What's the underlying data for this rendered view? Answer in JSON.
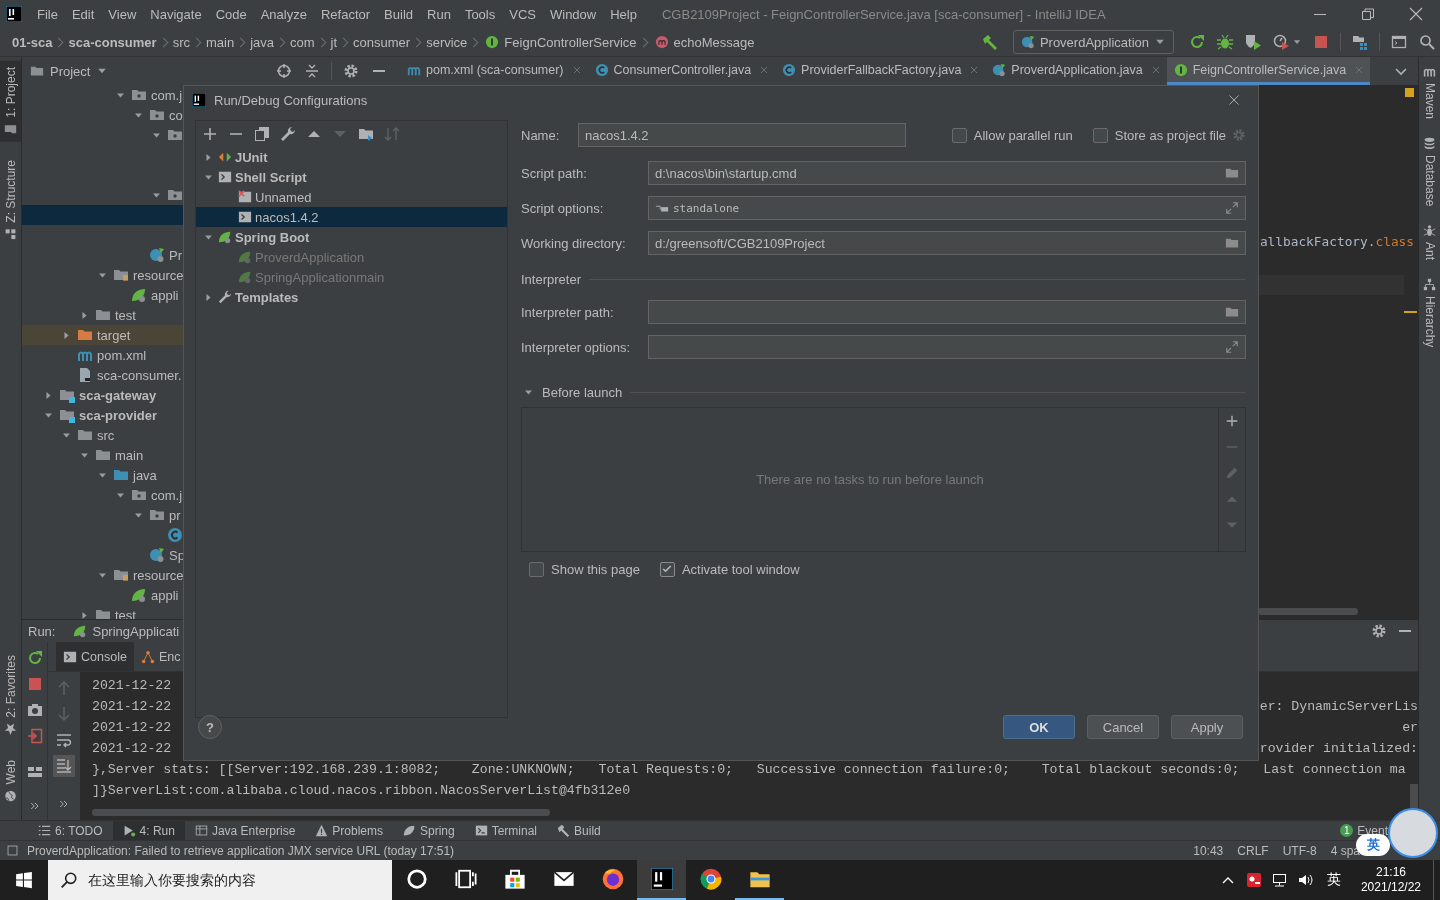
{
  "window": {
    "title": "CGB2109Project - FeignControllerService.java [sca-consumer] - IntelliJ IDEA"
  },
  "menu": [
    "File",
    "Edit",
    "View",
    "Navigate",
    "Code",
    "Analyze",
    "Refactor",
    "Build",
    "Run",
    "Tools",
    "VCS",
    "Window",
    "Help"
  ],
  "breadcrumbs": [
    {
      "label": "01-sca",
      "kind": "module"
    },
    {
      "label": "sca-consumer",
      "kind": "module"
    },
    {
      "label": "src",
      "kind": "dir"
    },
    {
      "label": "main",
      "kind": "dir"
    },
    {
      "label": "java",
      "kind": "dir"
    },
    {
      "label": "com",
      "kind": "dir"
    },
    {
      "label": "jt",
      "kind": "dir"
    },
    {
      "label": "consumer",
      "kind": "dir"
    },
    {
      "label": "service",
      "kind": "dir"
    },
    {
      "label": "FeignControllerService",
      "kind": "interface"
    },
    {
      "label": "echoMessage",
      "kind": "method"
    }
  ],
  "run_config": {
    "label": "ProverdApplication"
  },
  "left_strip": [
    {
      "label": "1: Project",
      "kind": "folder",
      "selected": true
    },
    {
      "label": "Z: Structure",
      "kind": "structure",
      "selected": false
    }
  ],
  "left_strip_bottom": [
    {
      "label": "2: Favorites",
      "kind": "star"
    },
    {
      "label": "Web",
      "kind": "globe"
    }
  ],
  "right_strip": [
    {
      "label": "Maven",
      "kind": "maven"
    },
    {
      "label": "Database",
      "kind": "database"
    },
    {
      "label": "Ant",
      "kind": "ant"
    },
    {
      "label": "Hierarchy",
      "kind": "hierarchy"
    }
  ],
  "project": {
    "title": "Project",
    "tree": [
      {
        "children": [
          {
            "children": [
              {
                "children": [
                  {
                    "children": [
                      {
                        "label": "com.j",
                        "kind": "package",
                        "expanded": true,
                        "selected": false,
                        "children": [
                          {
                            "label": "co",
                            "kind": "package",
                            "expanded": true,
                            "selected": false,
                            "children": [
                              {
                                "kind": "package",
                                "expanded": true,
                                "selected": false,
                                "children": [
                                  {
                                    "selected": false
                                  },
                                  {
                                    "selected": false
                                  }
                                ]
                              },
                              {
                                "kind": "package",
                                "expanded": true,
                                "selected": false,
                                "children": [
                                  {
                                    "selected": true
                                  },
                                  {
                                    "selected": false
                                  }
                                ]
                              }
                            ]
                          },
                          {
                            "label": "Pr",
                            "kind": "springapp",
                            "selected": false
                          }
                        ]
                      }
                    ]
                  },
                  {
                    "label": "resource",
                    "kind": "res",
                    "expanded": true,
                    "selected": false,
                    "children": [
                      {
                        "label": "appli",
                        "kind": "spring",
                        "selected": false
                      }
                    ]
                  }
                ]
              },
              {
                "label": "test",
                "kind": "folder",
                "expanded": false,
                "selected": false
              }
            ]
          },
          {
            "label": "target",
            "kind": "excluded",
            "expanded": false,
            "selected": false
          },
          {
            "label": "pom.xml",
            "kind": "maven",
            "selected": false
          },
          {
            "label": "sca-consumer.",
            "kind": "file",
            "selected": false
          }
        ]
      },
      {
        "label": "sca-gateway",
        "kind": "module",
        "expanded": false,
        "selected": false
      },
      {
        "label": "sca-provider",
        "kind": "module",
        "expanded": true,
        "selected": false,
        "children": [
          {
            "label": "src",
            "kind": "folder",
            "expanded": true,
            "selected": false,
            "children": [
              {
                "label": "main",
                "kind": "folder",
                "expanded": true,
                "selected": false,
                "children": [
                  {
                    "label": "java",
                    "kind": "src",
                    "expanded": true,
                    "selected": false,
                    "children": [
                      {
                        "label": "com.j",
                        "kind": "package",
                        "expanded": true,
                        "selected": false,
                        "children": [
                          {
                            "label": "pr",
                            "kind": "package",
                            "expanded": true,
                            "selected": false,
                            "children": [
                              {
                                "kind": "class",
                                "selected": false
                              }
                            ]
                          },
                          {
                            "label": "Sp",
                            "kind": "springapp",
                            "selected": false
                          }
                        ]
                      }
                    ]
                  },
                  {
                    "label": "resource",
                    "kind": "res",
                    "expanded": true,
                    "selected": false,
                    "children": [
                      {
                        "label": "appli",
                        "kind": "spring",
                        "selected": false
                      }
                    ]
                  }
                ]
              },
              {
                "label": "test",
                "kind": "folder",
                "expanded": false,
                "selected": false
              }
            ]
          }
        ]
      }
    ]
  },
  "editor_tabs": [
    {
      "label": "pom.xml (sca-consumer)",
      "kind": "maven",
      "selected": false
    },
    {
      "label": "ConsumerController.java",
      "kind": "class",
      "selected": false
    },
    {
      "label": "ProviderFallbackFactory.java",
      "kind": "class",
      "selected": false
    },
    {
      "label": "ProverdApplication.java",
      "kind": "springapp",
      "selected": false
    },
    {
      "label": "FeignControllerService.java",
      "kind": "interface",
      "selected": true
    }
  ],
  "editor": {
    "code": [
      {
        "text": "allbackFactory.",
        "kind": "plain"
      },
      {
        "text": "class",
        "kind": "keyword"
      }
    ]
  },
  "run_panel": {
    "label": "Run:",
    "config": "SpringApplicati",
    "tabs": [
      {
        "label": "Console",
        "kind": "console",
        "selected": true
      },
      {
        "label": "Enc",
        "kind": "nodes",
        "selected": false
      }
    ],
    "lines": [
      {
        "text": "2021-12-22"
      },
      {
        "text": "2021-12-22",
        "end": "er: DynamicServerLis"
      },
      {
        "text": "2021-12-22",
        "end": "er"
      },
      {
        "text": "2021-12-22",
        "end": "rovider initialized:"
      },
      {
        "text": "},Server stats: [[Server:192.168.239.1:8082;    Zone:UNKNOWN;   Total Requests:0;   Successive connection failure:0;    Total blackout seconds:0;   Last connection ma"
      },
      {
        "text": "]}ServerList:com.alibaba.cloud.nacos.ribbon.NacosServerList@4fb312e0"
      }
    ]
  },
  "tool_windows": [
    {
      "label": "6: TODO",
      "kind": "list",
      "selected": false
    },
    {
      "label": "4: Run",
      "kind": "run",
      "selected": true
    },
    {
      "label": "Java Enterprise",
      "kind": "table",
      "selected": false
    },
    {
      "label": "Problems",
      "kind": "warning",
      "selected": false
    },
    {
      "label": "Spring",
      "kind": "springgrey",
      "selected": false
    },
    {
      "label": "Terminal",
      "kind": "terminal",
      "selected": false
    },
    {
      "label": "Build",
      "kind": "hammergrey",
      "selected": false
    }
  ],
  "event_log": {
    "count": "1",
    "label": "Event"
  },
  "status_bar": {
    "message": "ProverdApplication: Failed to retrieve application JMX service URL (today 17:51)",
    "items": [
      "10:43",
      "CRLF",
      "UTF-8",
      "4 spa"
    ]
  },
  "ime_widget": {
    "label": "英"
  },
  "taskbar": {
    "search_placeholder": "在这里输入你要搜索的内容",
    "apps": [
      {
        "kind": "cortana",
        "selected": false,
        "running": false
      },
      {
        "kind": "taskview",
        "selected": false,
        "running": false
      },
      {
        "kind": "store",
        "selected": false,
        "running": false
      },
      {
        "kind": "mail",
        "selected": false,
        "running": false
      },
      {
        "kind": "firefox",
        "selected": false,
        "running": false
      },
      {
        "kind": "logo",
        "selected": true,
        "running": true
      },
      {
        "kind": "chrome",
        "selected": false,
        "running": false
      },
      {
        "kind": "explorer",
        "selected": false,
        "running": true
      }
    ],
    "ime": "英",
    "time": "21:16",
    "date": "2021/12/22"
  },
  "dialog": {
    "title": "Run/Debug Configurations",
    "tree": [
      {
        "label": "JUnit",
        "kind": "junit",
        "expanded": false,
        "selected": false
      },
      {
        "label": "Shell Script",
        "kind": "shell",
        "expanded": true,
        "selected": false,
        "children": [
          {
            "label": "Unnamed",
            "kind": "shellerr",
            "selected": false,
            "temporary": false
          },
          {
            "label": "nacos1.4.2",
            "kind": "shell",
            "selected": true,
            "temporary": false
          }
        ]
      },
      {
        "label": "Spring Boot",
        "kind": "spring",
        "expanded": true,
        "selected": false,
        "children": [
          {
            "label": "ProverdApplication",
            "kind": "spring",
            "selected": false,
            "temporary": true
          },
          {
            "label": "SpringApplicationmain",
            "kind": "spring",
            "selected": false,
            "temporary": true
          }
        ]
      },
      {
        "label": "Templates",
        "kind": "wrench",
        "expanded": false,
        "selected": false
      }
    ],
    "name": {
      "label": "Name:",
      "value": "nacos1.4.2"
    },
    "options": [
      {
        "label": "Allow parallel run",
        "checked": false
      },
      {
        "label": "Store as project file",
        "checked": false
      }
    ],
    "fields": [
      {
        "label": "Script path:",
        "value": "d:\\nacos\\bin\\startup.cmd",
        "kind": "browse"
      },
      {
        "label": "Script options:",
        "value": "standalone",
        "kind": "options"
      },
      {
        "label": "Working directory:",
        "value": "d:/greensoft/CGB2109Project",
        "kind": "browse"
      },
      {
        "label": "Interpreter",
        "kind": "section"
      },
      {
        "label": "Interpreter path:",
        "kind": "browse"
      },
      {
        "label": "Interpreter options:",
        "kind": "expand"
      }
    ],
    "before_launch": {
      "label": "Before launch",
      "expanded": true,
      "empty_text": "There are no tasks to run before launch"
    },
    "checks": [
      {
        "label": "Show this page",
        "checked": false
      },
      {
        "label": "Activate tool window",
        "checked": true
      }
    ],
    "help": "?",
    "buttons": [
      {
        "label": "OK",
        "kind": "default"
      },
      {
        "label": "Cancel",
        "kind": "normal"
      },
      {
        "label": "Apply",
        "kind": "normal"
      }
    ]
  }
}
